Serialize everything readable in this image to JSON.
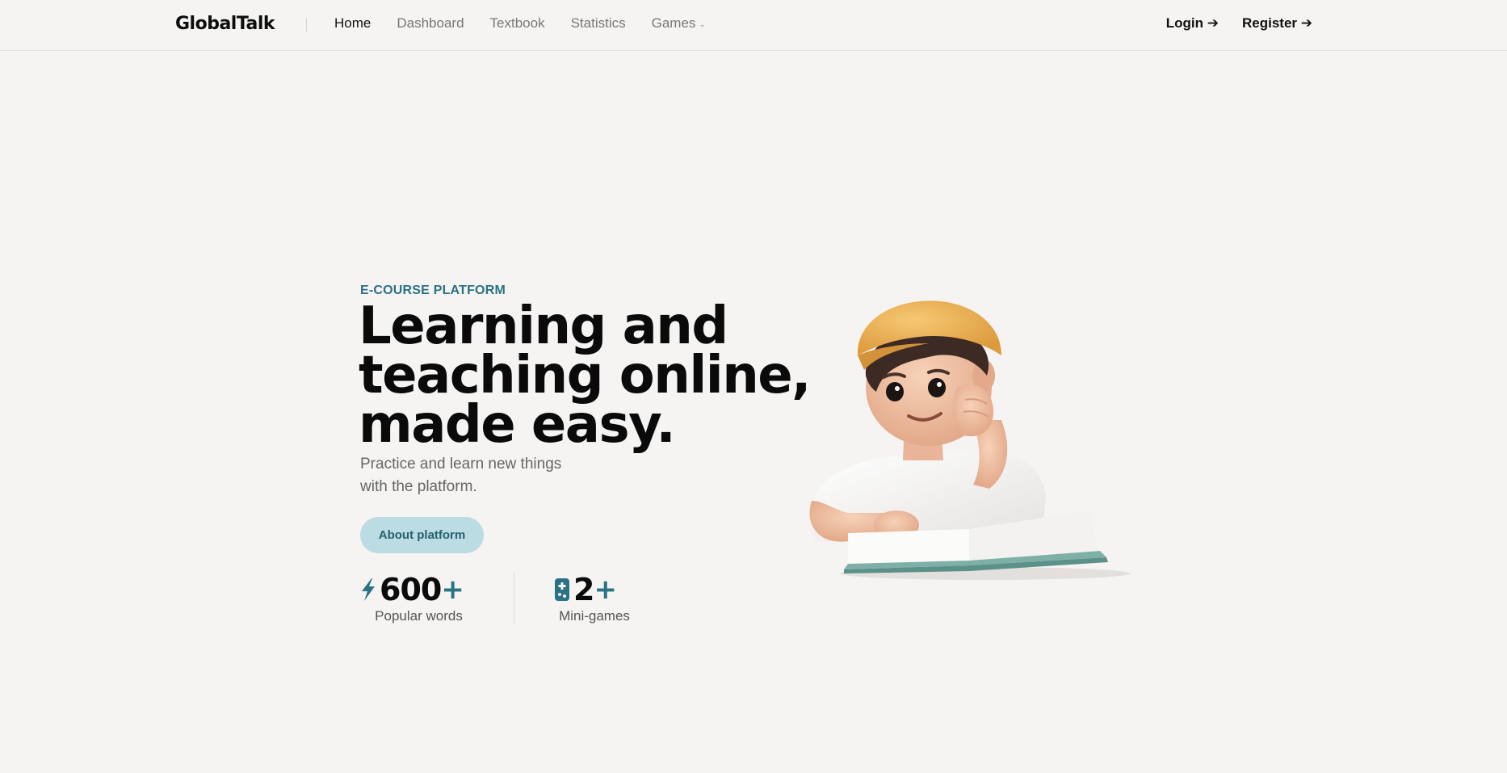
{
  "brand": {
    "name": "GlobalTalk"
  },
  "nav": {
    "items": [
      {
        "label": "Home",
        "active": true
      },
      {
        "label": "Dashboard",
        "active": false
      },
      {
        "label": "Textbook",
        "active": false
      },
      {
        "label": "Statistics",
        "active": false
      },
      {
        "label": "Games",
        "active": false,
        "has_dropdown": true
      }
    ]
  },
  "auth": {
    "login_label": "Login ➔",
    "register_label": "Register ➔"
  },
  "hero": {
    "eyebrow": "E-COURSE PLATFORM",
    "headline_line1": "Learning and",
    "headline_line2": "teaching online,",
    "headline_line3": "made easy.",
    "subtitle_line1": "Practice and learn new things",
    "subtitle_line2": "with the platform.",
    "cta_label": "About platform"
  },
  "stats": [
    {
      "icon": "lightning-icon",
      "number": "600",
      "plus": "+",
      "label": "Popular words"
    },
    {
      "icon": "gamepad-icon",
      "number": "2",
      "plus": "+",
      "label": "Mini-games"
    }
  ],
  "colors": {
    "background": "#f6f4f2",
    "accent": "#2a7284",
    "button_bg": "#bcdce4",
    "cap": "#f0b550"
  }
}
